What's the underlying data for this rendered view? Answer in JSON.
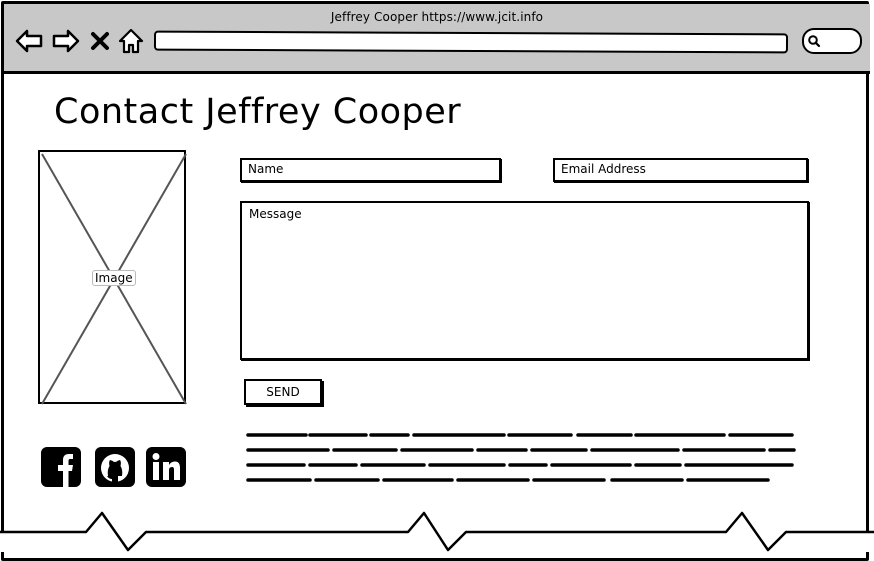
{
  "window": {
    "title": "Jeffrey Cooper https://www.jcit.info"
  },
  "toolbar": {
    "icons": [
      "back-arrow-icon",
      "forward-arrow-icon",
      "close-x-icon",
      "home-icon",
      "search-icon"
    ]
  },
  "page": {
    "title": "Contact Jeffrey Cooper"
  },
  "image": {
    "label": "Image"
  },
  "form": {
    "name_placeholder": "Name",
    "email_placeholder": "Email Address",
    "message_placeholder": "Message",
    "send_label": "SEND"
  },
  "social": {
    "icons": [
      "facebook-icon",
      "github-icon",
      "linkedin-icon"
    ]
  },
  "colors": {
    "chrome_background": "#c8c8c8",
    "ink": "#000000",
    "placeholder_stroke": "#555555"
  }
}
